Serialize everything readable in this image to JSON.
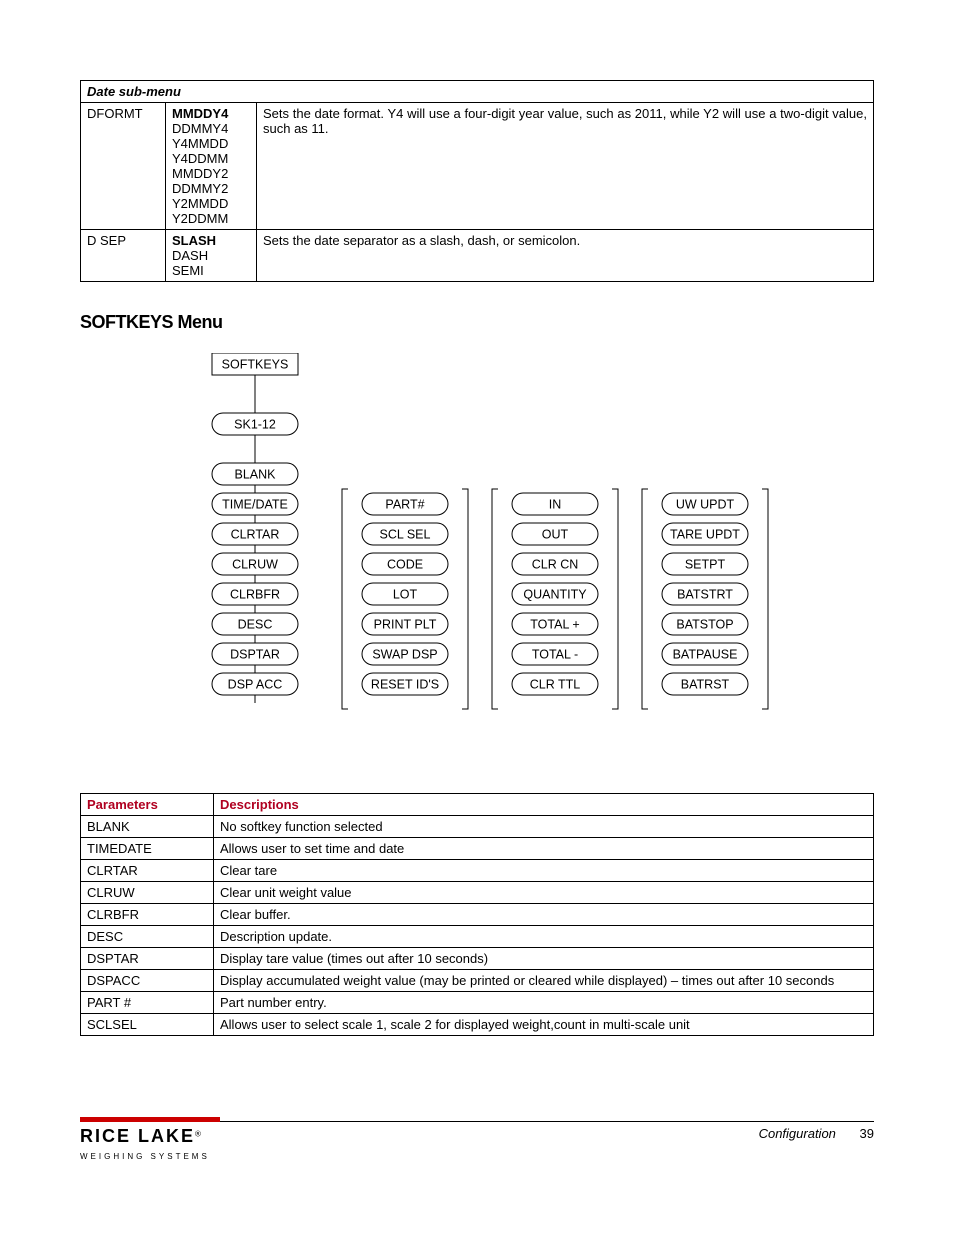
{
  "date_table": {
    "submenu_title": "Date sub-menu",
    "rows": [
      {
        "param": "DFORMT",
        "options": [
          "MMDDY4",
          "DDMMY4",
          "Y4MMDD",
          "Y4DDMM",
          "MMDDY2",
          "DDMMY2",
          "Y2MMDD",
          "Y2DDMM"
        ],
        "bold_first": true,
        "desc": "Sets the date format. Y4 will use a four-digit year value, such as 2011, while Y2 will use a two-digit value, such as 11."
      },
      {
        "param": "D SEP",
        "options": [
          "SLASH",
          "DASH",
          "SEMI"
        ],
        "bold_first": true,
        "desc": "Sets the date separator as a slash, dash, or semicolon."
      }
    ]
  },
  "softkeys_heading": "SOFTKEYS Menu",
  "diagram": {
    "root": "SOFTKEYS",
    "sk": "SK1-12",
    "columns": [
      [
        "BLANK",
        "TIME/DATE",
        "CLRTAR",
        "CLRUW",
        "CLRBFR",
        "DESC",
        "DSPTAR",
        "DSP ACC"
      ],
      [
        "PART#",
        "SCL SEL",
        "CODE",
        "LOT",
        "PRINT PLT",
        "SWAP DSP",
        "RESET ID'S"
      ],
      [
        "IN",
        "OUT",
        "CLR CN",
        "QUANTITY",
        "TOTAL +",
        "TOTAL -",
        "CLR TTL"
      ],
      [
        "UW UPDT",
        "TARE UPDT",
        "SETPT",
        "BATSTRT",
        "BATSTOP",
        "BATPAUSE",
        "BATRST"
      ]
    ]
  },
  "param_table": {
    "headers": [
      "Parameters",
      "Descriptions"
    ],
    "rows": [
      [
        "BLANK",
        "No softkey function selected"
      ],
      [
        "TIMEDATE",
        "Allows user to set time and date"
      ],
      [
        "CLRTAR",
        "Clear tare"
      ],
      [
        "CLRUW",
        "Clear unit weight value"
      ],
      [
        "CLRBFR",
        "Clear buffer."
      ],
      [
        "DESC",
        "Description update."
      ],
      [
        "DSPTAR",
        "Display tare value (times out after 10 seconds)"
      ],
      [
        "DSPACC",
        "Display accumulated weight value (may be printed or cleared while displayed) – times out after 10 seconds"
      ],
      [
        "PART #",
        "Part number entry."
      ],
      [
        "SCLSEL",
        "Allows user to select scale 1, scale 2 for displayed weight,count in multi-scale unit"
      ]
    ]
  },
  "footer": {
    "logo_main": "RICE LAKE",
    "logo_sub": "WEIGHING SYSTEMS",
    "section": "Configuration",
    "page": "39"
  }
}
